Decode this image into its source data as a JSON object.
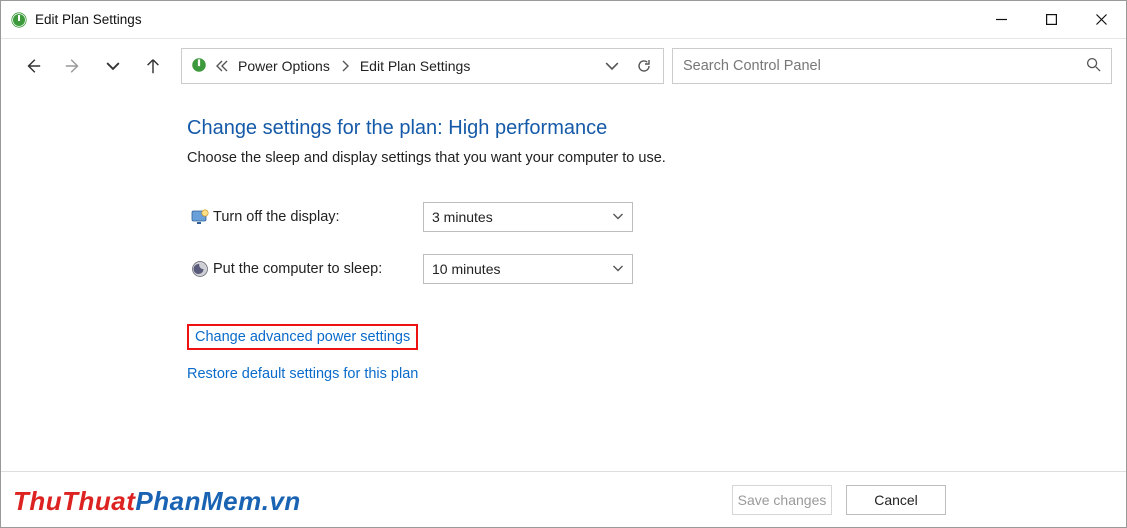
{
  "window": {
    "title": "Edit Plan Settings"
  },
  "breadcrumb": {
    "items": [
      "Power Options",
      "Edit Plan Settings"
    ]
  },
  "search": {
    "placeholder": "Search Control Panel"
  },
  "page": {
    "heading": "Change settings for the plan: High performance",
    "subtext": "Choose the sleep and display settings that you want your computer to use."
  },
  "settings": {
    "display_off": {
      "label": "Turn off the display:",
      "value": "3 minutes"
    },
    "sleep": {
      "label": "Put the computer to sleep:",
      "value": "10 minutes"
    }
  },
  "links": {
    "advanced": "Change advanced power settings",
    "restore": "Restore default settings for this plan"
  },
  "footer": {
    "save": "Save changes",
    "cancel": "Cancel"
  },
  "watermark": {
    "part1": "ThuThuat",
    "part2": "PhanMem.vn"
  }
}
